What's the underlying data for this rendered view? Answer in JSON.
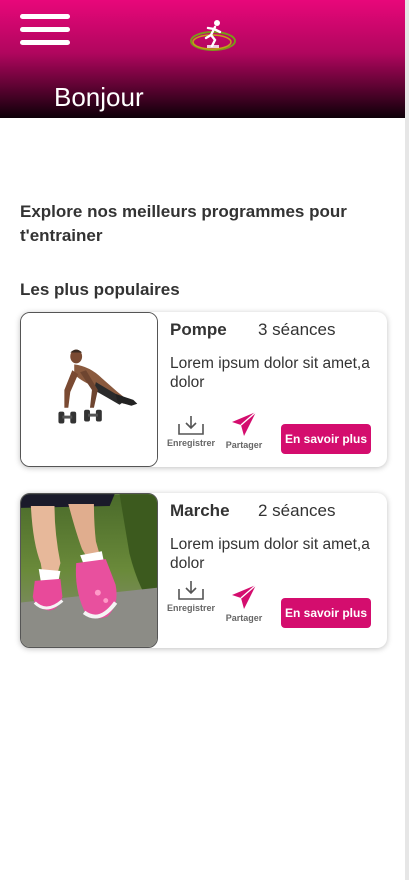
{
  "header": {
    "greeting": "Bonjour"
  },
  "main": {
    "intro": "Explore nos meilleurs programmes pour t'entrainer",
    "section_title": "Les plus populaires",
    "cards": [
      {
        "title": "Pompe",
        "sessions": "3 séances",
        "description": "Lorem ipsum dolor sit amet,a dolor",
        "save_label": "Enregistrer",
        "share_label": "Partager",
        "more_label": "En savoir plus",
        "image": "pushup-photo"
      },
      {
        "title": "Marche",
        "sessions": "2 séances",
        "description": "Lorem ipsum dolor sit amet,a dolor",
        "save_label": "Enregistrer",
        "share_label": "Partager",
        "more_label": "En savoir plus",
        "image": "walking-photo"
      }
    ]
  },
  "colors": {
    "accent": "#d40d6e",
    "header_top": "#e8077a",
    "header_bottom": "#0d0008"
  },
  "icons": [
    "menu-icon",
    "logo-icon",
    "download-icon",
    "paper-plane-icon"
  ]
}
